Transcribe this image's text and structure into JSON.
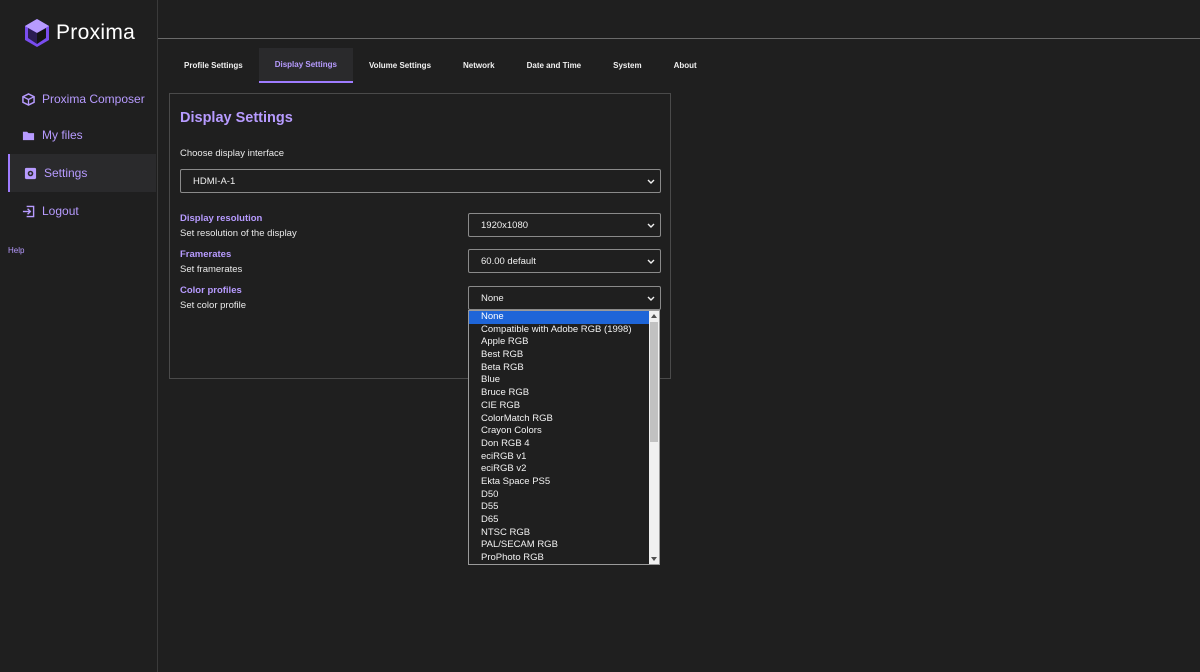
{
  "app": {
    "name": "Proxima"
  },
  "sidebar": {
    "items": [
      {
        "label": "Proxima Composer",
        "icon": "cube-icon"
      },
      {
        "label": "My files",
        "icon": "folder-icon"
      },
      {
        "label": "Settings",
        "icon": "settings-icon"
      },
      {
        "label": "Logout",
        "icon": "logout-icon"
      }
    ],
    "help": "Help"
  },
  "tabs": [
    {
      "label": "Profile Settings"
    },
    {
      "label": "Display Settings"
    },
    {
      "label": "Volume Settings"
    },
    {
      "label": "Network"
    },
    {
      "label": "Date and Time"
    },
    {
      "label": "System"
    },
    {
      "label": "About"
    }
  ],
  "active_tab": "Display Settings",
  "panel": {
    "title": "Display Settings",
    "interface": {
      "label": "Choose display interface",
      "value": "HDMI-A-1"
    },
    "resolution": {
      "label": "Display resolution",
      "description": "Set resolution of the display",
      "value": "1920x1080"
    },
    "framerates": {
      "label": "Framerates",
      "description": "Set framerates",
      "value": "60.00 default"
    },
    "color_profiles": {
      "label": "Color profiles",
      "description": "Set color profile",
      "value": "None"
    }
  },
  "color_profile_options": [
    "None",
    "Compatible with Adobe RGB (1998)",
    "Apple RGB",
    "Best RGB",
    "Beta RGB",
    "Blue",
    "Bruce RGB",
    "CIE RGB",
    "ColorMatch RGB",
    "Crayon Colors",
    "Don RGB 4",
    "eciRGB v1",
    "eciRGB v2",
    "Ekta Space PS5",
    "D50",
    "D55",
    "D65",
    "NTSC RGB",
    "PAL/SECAM RGB",
    "ProPhoto RGB"
  ],
  "colors": {
    "accent": "#b79bff",
    "background": "#1f1f1f",
    "selection": "#1e65d8"
  }
}
